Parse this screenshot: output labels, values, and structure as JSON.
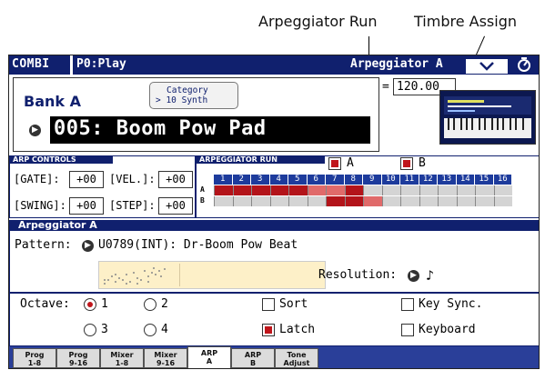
{
  "callouts": {
    "arp_run": "Arpeggiator Run",
    "timbre_assign": "Timbre Assign"
  },
  "titlebar": {
    "mode": "COMBI",
    "page": "P0:Play",
    "right_title": "Arpeggiator A",
    "colors": {
      "bar": "#10206e"
    }
  },
  "program": {
    "bank": "Bank A",
    "category_line1": "Category",
    "category_line2": "> 10 Synth",
    "name": "005: Boom Pow Pad",
    "tempo_prefix": "=",
    "tempo": "120.00"
  },
  "arp_controls": {
    "title": "ARP CONTROLS",
    "gate_label": "[GATE]:",
    "gate": "+00",
    "vel_label": "[VEL.]:",
    "vel": "+00",
    "swing_label": "[SWING]:",
    "swing": "+00",
    "step_label": "[STEP]:",
    "step": "+00"
  },
  "arp_run": {
    "title": "ARPEGGIATOR RUN",
    "a_label": "A",
    "a_checked": true,
    "b_label": "B",
    "b_checked": true,
    "columns": [
      "1",
      "2",
      "3",
      "4",
      "5",
      "6",
      "7",
      "8",
      "9",
      "10",
      "11",
      "12",
      "13",
      "14",
      "15",
      "16"
    ],
    "row_a_label": "A",
    "row_b_label": "B",
    "row_a_active": [
      true,
      true,
      true,
      true,
      true,
      true,
      true,
      true,
      false,
      false,
      false,
      false,
      false,
      false,
      false,
      false
    ],
    "row_a_light": [
      false,
      false,
      false,
      false,
      false,
      true,
      true,
      false,
      false,
      false,
      false,
      false,
      false,
      false,
      false,
      false
    ],
    "row_b_active": [
      false,
      false,
      false,
      false,
      false,
      false,
      true,
      true,
      false,
      false,
      false,
      false,
      false,
      false,
      false,
      false
    ],
    "row_b_light": [
      false,
      false,
      false,
      false,
      false,
      false,
      false,
      false,
      true,
      false,
      false,
      false,
      false,
      false,
      false,
      false
    ]
  },
  "arpeggiator_a": {
    "title": "Arpeggiator A",
    "pattern_label": "Pattern:",
    "pattern": "U0789(INT): Dr-Boom Pow Beat",
    "resolution_label": "Resolution:",
    "resolution_icon": "eighth-note-icon",
    "resolution_glyph": "♪",
    "octave_label": "Octave:",
    "octave_options": [
      "1",
      "2",
      "3",
      "4"
    ],
    "octave_selected": "1",
    "sort_label": "Sort",
    "sort": false,
    "latch_label": "Latch",
    "latch": true,
    "key_sync_label": "Key Sync.",
    "key_sync": false,
    "keyboard_label": "Keyboard",
    "keyboard": false
  },
  "tabs": [
    {
      "l1": "Prog",
      "l2": "1-8"
    },
    {
      "l1": "Prog",
      "l2": "9-16"
    },
    {
      "l1": "Mixer",
      "l2": "1-8"
    },
    {
      "l1": "Mixer",
      "l2": "9-16"
    },
    {
      "l1": "ARP",
      "l2": "A"
    },
    {
      "l1": "ARP",
      "l2": "B"
    },
    {
      "l1": "Tone",
      "l2": "Adjust"
    }
  ],
  "active_tab": "ARP A",
  "colors": {
    "active_red": "#b3141a",
    "light_red": "#e06a6a",
    "inactive_cell": "#d4d4d4",
    "header_blue": "#1d3b9c"
  }
}
